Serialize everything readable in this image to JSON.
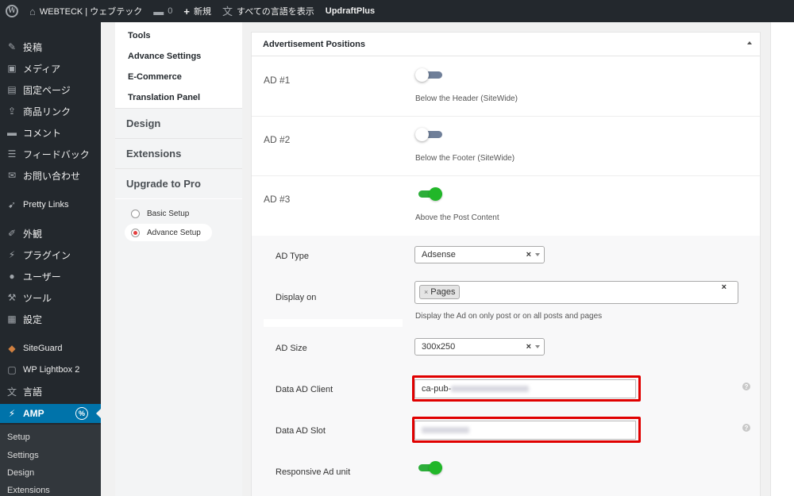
{
  "adminbar": {
    "site_name": "WEBTECK | ウェブテック",
    "comments_count": "0",
    "new_label": "新規",
    "show_all_languages": "すべての言語を表示",
    "updraft": "UpdraftPlus"
  },
  "sidebar": {
    "items": [
      {
        "label": "投稿",
        "icon": "pin-icon"
      },
      {
        "label": "メディア",
        "icon": "media-icon"
      },
      {
        "label": "固定ページ",
        "icon": "pages-icon"
      },
      {
        "label": "商品リンク",
        "icon": "product-link-icon"
      },
      {
        "label": "コメント",
        "icon": "comment-icon"
      },
      {
        "label": "フィードバック",
        "icon": "feedback-icon"
      },
      {
        "label": "お問い合わせ",
        "icon": "mail-icon"
      },
      {
        "label": "Pretty Links",
        "icon": "pretty-links-icon"
      },
      {
        "label": "外観",
        "icon": "brush-icon"
      },
      {
        "label": "プラグイン",
        "icon": "plugin-icon"
      },
      {
        "label": "ユーザー",
        "icon": "user-icon"
      },
      {
        "label": "ツール",
        "icon": "wrench-icon"
      },
      {
        "label": "設定",
        "icon": "settings-icon"
      },
      {
        "label": "SiteGuard",
        "icon": "siteguard-icon"
      },
      {
        "label": "WP Lightbox 2",
        "icon": "lightbox-icon"
      },
      {
        "label": "言語",
        "icon": "language-icon"
      },
      {
        "label": "AMP",
        "icon": "amp-icon"
      }
    ],
    "submenu": [
      "Setup",
      "Settings",
      "Design",
      "Extensions"
    ]
  },
  "nav": {
    "subitems": [
      "Tools",
      "Advance Settings",
      "E-Commerce",
      "Translation Panel"
    ],
    "sections": [
      "Design",
      "Extensions",
      "Upgrade to Pro"
    ],
    "steps": [
      {
        "label": "Basic Setup",
        "selected": false
      },
      {
        "label": "Advance Setup",
        "selected": true
      }
    ]
  },
  "panel": {
    "title": "Advertisement Positions",
    "ads": [
      {
        "title": "AD #1",
        "desc": "Below the Header (SiteWide)",
        "enabled": false
      },
      {
        "title": "AD #2",
        "desc": "Below the Footer (SiteWide)",
        "enabled": false
      },
      {
        "title": "AD #3",
        "desc": "Above the Post Content",
        "enabled": true
      }
    ],
    "ad3": {
      "type_label": "AD Type",
      "type_value": "Adsense",
      "display_label": "Display on",
      "display_tag": "Pages",
      "display_desc": "Display the Ad on only post or on all posts and pages",
      "size_label": "AD Size",
      "size_value": "300x250",
      "client_label": "Data AD Client",
      "client_value": "ca-pub-",
      "slot_label": "Data AD Slot",
      "responsive_label": "Responsive Ad unit",
      "responsive_enabled": true
    }
  },
  "colors": {
    "admin_dark": "#23282d",
    "active_blue": "#0073aa",
    "toggle_on": "#21b729",
    "highlight_red": "#e00000"
  }
}
